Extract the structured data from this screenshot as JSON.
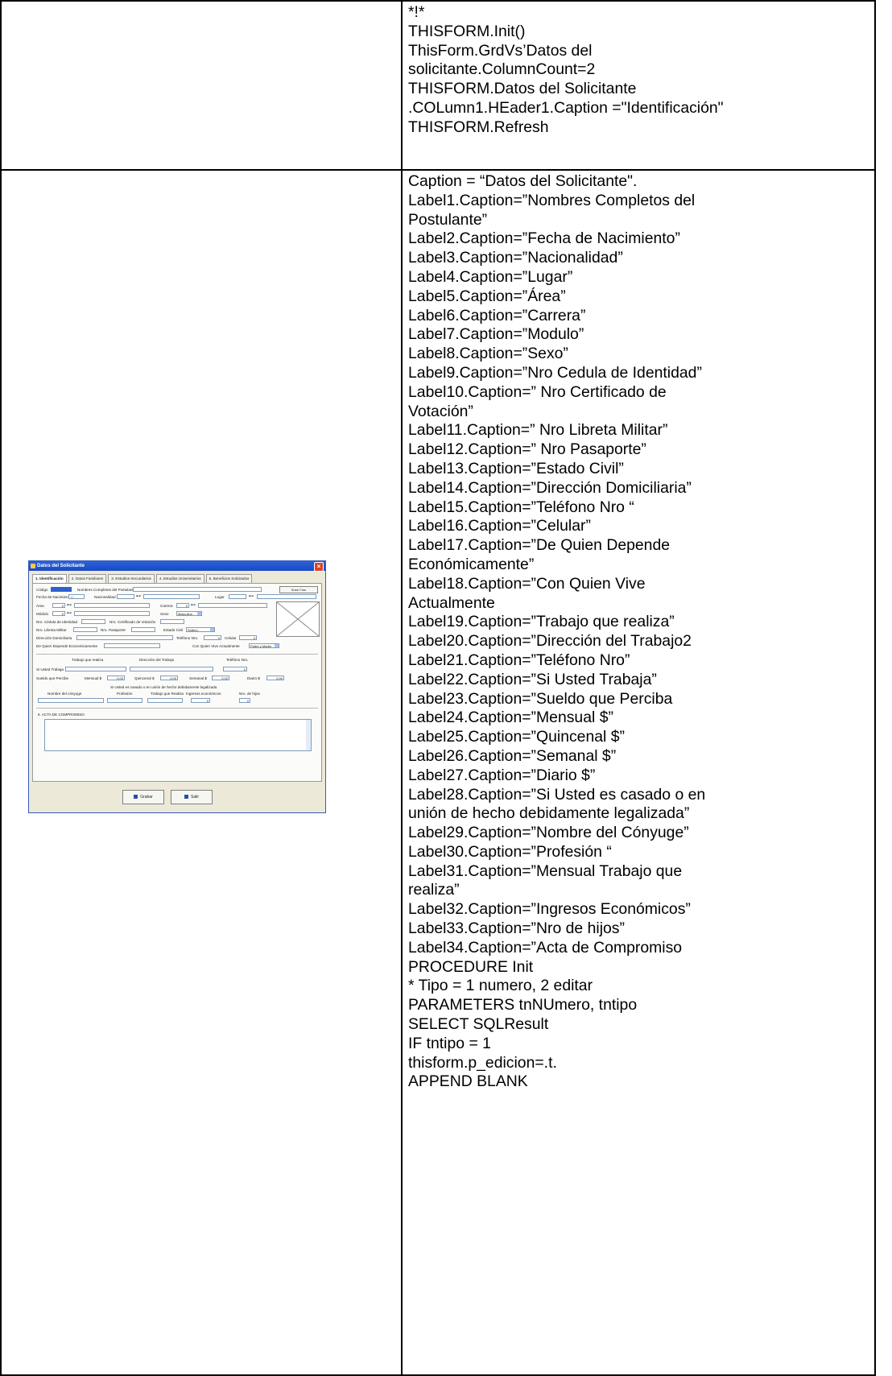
{
  "top_code": [
    "*!*",
    "THISFORM.Init()",
    "ThisForm.GrdVs’Datos del",
    "solicitante.ColumnCount=2",
    "THISFORM.Datos del Solicitante",
    ".COLumn1.HEader1.Caption =\"Identificación\"",
    "THISFORM.Refresh"
  ],
  "bottom_code": [
    "Caption = “Datos del Solicitante\".",
    "Label1.Caption=”Nombres Completos del",
    "Postulante”",
    "Label2.Caption=”Fecha de Nacimiento”",
    "Label3.Caption=”Nacionalidad”",
    "Label4.Caption=”Lugar”",
    "Label5.Caption=”Área”",
    "Label6.Caption=”Carrera”",
    "Label7.Caption=”Modulo”",
    "Label8.Caption=”Sexo”",
    "Label9.Caption=”Nro Cedula de Identidad”",
    "Label10.Caption=” Nro Certificado de",
    "Votación”",
    "Label11.Caption=” Nro Libreta Militar”",
    "Label12.Caption=” Nro Pasaporte”",
    "Label13.Caption=”Estado Civil”",
    "Label14.Caption=”Dirección Domiciliaria”",
    "Label15.Caption=”Teléfono Nro “",
    "Label16.Caption=”Celular”",
    "Label17.Caption=”De Quien Depende",
    "Económicamente”",
    "Label18.Caption=”Con Quien Vive",
    "Actualmente",
    "Label19.Caption=”Trabajo que realiza”",
    "Label20.Caption=”Dirección del Trabajo2",
    "Label21.Caption=”Teléfono Nro”",
    "Label22.Caption=”Si Usted Trabaja”",
    "Label23.Caption=”Sueldo que Perciba",
    "Label24.Caption=”Mensual $”",
    "Label25.Caption=”Quincenal $”",
    "Label26.Caption=”Semanal $”",
    "Label27.Caption=”Diario $”",
    "Label28.Caption=”Si Usted es casado o en",
    "unión de hecho debidamente legalizada”",
    "Label29.Caption=”Nombre del Cónyuge”",
    "Label30.Caption=”Profesión “",
    "Label31.Caption=”Mensual Trabajo que",
    "realiza”",
    "Label32.Caption=”Ingresos Económicos”",
    "Label33.Caption=”Nro de hijos”",
    "Label34.Caption=”Acta de Compromiso",
    "PROCEDURE Init",
    "* Tipo = 1 numero, 2 editar",
    "PARAMETERS tnNUmero, tntipo",
    "SELECT SQLResult",
    "IF tntipo = 1",
    "thisform.p_edicion=.t.",
    "APPEND BLANK"
  ],
  "form": {
    "title": "Datos del Solicitante",
    "tabs": [
      "1. Identificación",
      "2. Datos Familiares",
      "3. Estudios Secundarios",
      "4. Estudios Universitarios",
      "5. Beneficios Solicitados"
    ],
    "codigo": "Código",
    "nombres": "Nombres Completos del Postulante",
    "sube_foto": "Sube Foto",
    "fecha": "Fecha de Nacimiento",
    "fecha_val": "/ /",
    "nacionalidad": "Nacionalidad",
    "lugar": "Lugar",
    "area": "Área",
    "carrera": "Carrera",
    "modulo": "Módulo",
    "sexo": "Sexo",
    "sexo_val": "Masculino",
    "cedula": "Nro. Cédula de Identidad",
    "certificado": "Nro. Certificado de Votación",
    "libreta": "Nro. Libreta Militar",
    "pasaporte": "Nro. Pasaporte",
    "estado_civil": "Estado Civil",
    "estado_val": "Soltero",
    "direccion": "Dirección Domiciliaria",
    "telefono": "Teléfono Nro.",
    "celular": "Celular",
    "depende": "De Quien Depende Economicamente",
    "vive": "Con Quien Vive Actualmente",
    "vive_val": "Padre y Madre",
    "trabajo": "Trabajo que realiza",
    "dir_trabajo": "Dirección del Trabajo",
    "tel_trabajo": "Teléfono Nro.",
    "si_trabaja": "Si Usted Trabaja",
    "sueldo": "Sueldo que Percibe",
    "mensual": "Mensual $",
    "quincenal": "Quincenal $",
    "semanal": "Semanal $",
    "diario": "Diario $",
    "casado": "Si Usted es casado o en unión de hecho debidamente legalizada",
    "conyuge": "Nombre del cónyuge",
    "profesion": "Profesión",
    "trabajo_realiza": "Trabajo que Realiza",
    "ingresos": "Ingresos económicos",
    "hijos": "Nro. de hijos",
    "acta": "6. ACTA DE COMPROMISO",
    "zero": "0",
    "money": "0.00",
    "grabar": "Grabar",
    "salir": "Salir"
  }
}
